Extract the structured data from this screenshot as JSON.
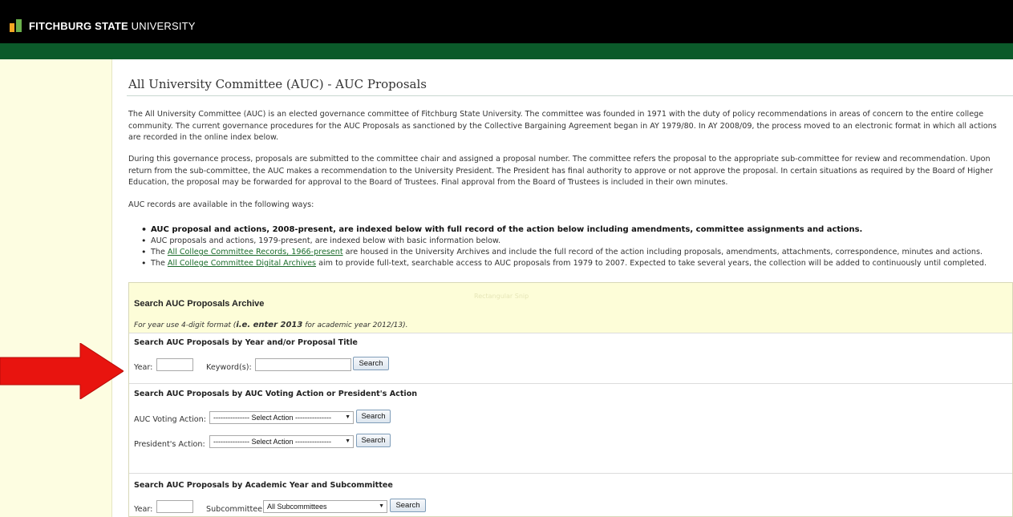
{
  "header": {
    "brand_bold": "FITCHBURG STATE",
    "brand_light": "UNIVERSITY",
    "colors": {
      "topbar": "#000000",
      "greenbar": "#0b5a2a",
      "sidebar": "#fdfde1",
      "link": "#1a6b2a",
      "arrow": "#e8140f"
    }
  },
  "page": {
    "title": "All University Committee (AUC) - AUC Proposals",
    "para1": "The All University Committee (AUC) is an elected governance committee of Fitchburg State University. The committee was founded in 1971 with the duty of policy recommendations in areas of concern to the entire college community. The current governance procedures for the AUC Proposals as sanctioned by the Collective Bargaining Agreement began in AY 1979/80. In AY 2008/09, the process moved to an electronic format in which all actions are recorded in the online index below.",
    "para2": "During this governance process, proposals are submitted to the committee chair and assigned a proposal number. The committee refers the proposal to the appropriate sub-committee for review and recommendation. Upon return from the sub-committee, the AUC makes a recommendation to the University President. The President has final authority to approve or not approve the proposal. In certain situations as required by the Board of Higher Education, the proposal may be forwarded for approval to the Board of Trustees. Final approval from the Board of Trustees is included in their own minutes.",
    "para3": "AUC records are available in the following ways:",
    "bullet1": "AUC proposal and actions, 2008-present, are indexed below with full record of the action below including amendments, committee assignments and actions.",
    "bullet2": "AUC proposals and actions, 1979-present, are indexed below with basic information below.",
    "bullet3_pre": "The",
    "bullet3_link": "All College Committee Records, 1966-present",
    "bullet3_post": "are housed in the University Archives and include the full record of the action including proposals, amendments, attachments, correspondence, minutes and actions.",
    "bullet4_pre": "The",
    "bullet4_link": "All College Committee Digital Archives",
    "bullet4_post": "aim to provide full-text, searchable access to AUC proposals from 1979 to 2007. Expected to take several years, the collection will be added to continuously until completed."
  },
  "search": {
    "title": "Search AUC Proposals Archive",
    "hint_pre": "For year use 4-digit format (",
    "hint_bold": "i.e. enter 2013",
    "hint_post": "for academic year 2012/13).",
    "ghost_tip": "Rectangular Snip",
    "section1": {
      "title": "Search AUC Proposals by Year and/or Proposal Title",
      "year_label": "Year:",
      "year_value": "",
      "keyword_label": "Keyword(s):",
      "keyword_value": "",
      "button": "Search"
    },
    "section2": {
      "title": "Search AUC Proposals by AUC Voting Action or President's Action",
      "voting_label": "AUC Voting Action:",
      "voting_selected": "--------------- Select Action ---------------",
      "president_label": "President's Action:",
      "president_selected": "--------------- Select Action ---------------",
      "button": "Search"
    },
    "section3": {
      "title": "Search AUC Proposals by Academic Year and Subcommittee",
      "year_label": "Year:",
      "year_value": "",
      "subcommittee_label": "Subcommittee:",
      "subcommittee_selected": "All Subcommittees",
      "button": "Search"
    }
  },
  "icons": {
    "arrow": "red-arrow-right-icon",
    "dropdown": "chevron-down-icon",
    "logo": "fitchburg-logo-icon"
  }
}
